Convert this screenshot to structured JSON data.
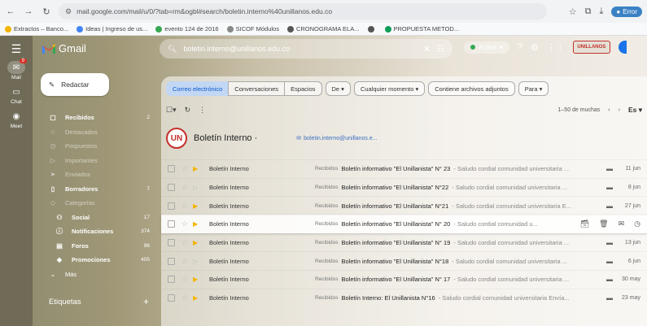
{
  "browser": {
    "url": "mail.google.com/mail/u/0/?tab=rm&ogbl#search/boletin.interno%40unillanos.edu.co",
    "profile_label": "Error"
  },
  "bookmarks": [
    {
      "label": "Extractos – Banco...",
      "color": "#f4b400"
    },
    {
      "label": "Ideas | Ingreso de us...",
      "color": "#4285f4"
    },
    {
      "label": "evento 124 de 2016",
      "color": "#34a853"
    },
    {
      "label": "SICOF Módulos",
      "color": "#888888"
    },
    {
      "label": "CRONOGRAMA ELA...",
      "color": "#555555"
    },
    {
      "label": "",
      "color": "#555555"
    },
    {
      "label": "PROPUESTA METOD...",
      "color": "#0f9d58"
    }
  ],
  "rail": [
    {
      "label": "Mail",
      "icon": "mail-icon",
      "badge": "9",
      "active": true
    },
    {
      "label": "Chat",
      "icon": "chat-icon",
      "badge": "",
      "active": false
    },
    {
      "label": "Meet",
      "icon": "meet-icon",
      "badge": "",
      "active": false
    }
  ],
  "app": {
    "name": "Gmail",
    "search_value": "boletin.interno@unillanos.edu.co",
    "status": "Active",
    "compose_label": "Redactar",
    "org_logo_text": "UNILLANOS",
    "labels_heading": "Etiquetas"
  },
  "sidebar": [
    {
      "label": "Recibidos",
      "icon": "inbox-icon",
      "count": "2",
      "bold": true,
      "dim": false,
      "sub": false
    },
    {
      "label": "Destacados",
      "icon": "star-icon",
      "count": "",
      "bold": false,
      "dim": true,
      "sub": false
    },
    {
      "label": "Pospuestos",
      "icon": "clock-icon",
      "count": "",
      "bold": false,
      "dim": true,
      "sub": false
    },
    {
      "label": "Importantes",
      "icon": "label-icon",
      "count": "",
      "bold": false,
      "dim": true,
      "sub": false
    },
    {
      "label": "Enviados",
      "icon": "send-icon",
      "count": "",
      "bold": false,
      "dim": true,
      "sub": false
    },
    {
      "label": "Borradores",
      "icon": "draft-icon",
      "count": "7",
      "bold": true,
      "dim": false,
      "sub": false
    },
    {
      "label": "Categorías",
      "icon": "tag-icon",
      "count": "",
      "bold": false,
      "dim": true,
      "sub": false
    },
    {
      "label": "Social",
      "icon": "people-icon",
      "count": "17",
      "bold": true,
      "dim": false,
      "sub": true
    },
    {
      "label": "Notificaciones",
      "icon": "info-icon",
      "count": "374",
      "bold": true,
      "dim": false,
      "sub": true
    },
    {
      "label": "Foros",
      "icon": "forum-icon",
      "count": "96",
      "bold": true,
      "dim": false,
      "sub": true
    },
    {
      "label": "Promociones",
      "icon": "promo-icon",
      "count": "405",
      "bold": true,
      "dim": false,
      "sub": true
    },
    {
      "label": "Más",
      "icon": "chevron-down-icon",
      "count": "",
      "bold": false,
      "dim": false,
      "sub": false
    }
  ],
  "chips": {
    "segmented": [
      "Correo electrónico",
      "Conversaciones",
      "Espacios"
    ],
    "filters": [
      "De ▾",
      "Cualquier momento ▾",
      "Contiene archivos adjuntos",
      "Para ▾"
    ]
  },
  "toolbar": {
    "range": "1–50 de muchas",
    "lang": "Es ▾"
  },
  "sender": {
    "initials": "UN",
    "name": "Boletín Interno ·",
    "email": "boletin.interno@unillanos.e..."
  },
  "emails": [
    {
      "sender": "Boletín Interno",
      "tag": "Recibidos",
      "subject": "Boletín informativo \"El Unillanista\" N° 23",
      "snippet": " - Saludo cordial comunidad universitaria ...",
      "date": "11 jun",
      "important": true,
      "hover": false
    },
    {
      "sender": "Boletín Interno",
      "tag": "Recibidos",
      "subject": "Boletín informativo \"El Unillanista\" N°22",
      "snippet": " - Saludo cordial comunidad universitaria ...",
      "date": "8 jun",
      "important": false,
      "hover": false
    },
    {
      "sender": "Boletín Interno",
      "tag": "Recibidos",
      "subject": "Boletín informativo \"El Unillanista\" N°21",
      "snippet": " - Saludo cordial comunidad universitaria E...",
      "date": "27 jun",
      "important": true,
      "hover": false
    },
    {
      "sender": "Boletín Interno",
      "tag": "Recibidos",
      "subject": "Boletín informativo \"El Unillanista\" N° 20",
      "snippet": " - Saludo cordial comunidad u...",
      "date": "",
      "important": true,
      "hover": true
    },
    {
      "sender": "Boletín Interno",
      "tag": "Recibidos",
      "subject": "Boletín informativo \"El Unillanista\" N° 19",
      "snippet": " - Saludo cordial comunidad universitaria ...",
      "date": "13 jun",
      "important": true,
      "hover": false
    },
    {
      "sender": "Boletín Interno",
      "tag": "Recibidos",
      "subject": "Boletín informativo \"El Unillanista\" N°18",
      "snippet": " - Saludo cordial comunidad universitaria ...",
      "date": "6 jun",
      "important": false,
      "hover": false
    },
    {
      "sender": "Boletín Interno",
      "tag": "Recibidos",
      "subject": "Boletín informativo \"El Unillanista\" N° 17",
      "snippet": " - Saludo cordial comunidad universitaria ...",
      "date": "30 may",
      "important": true,
      "hover": false
    },
    {
      "sender": "Boletín Interno",
      "tag": "Recibidos",
      "subject": "Boletín Interno: El Unillanista N°16",
      "snippet": " - Saludo cordial comunidad universitaria Envía...",
      "date": "23 may",
      "important": true,
      "hover": false
    }
  ]
}
